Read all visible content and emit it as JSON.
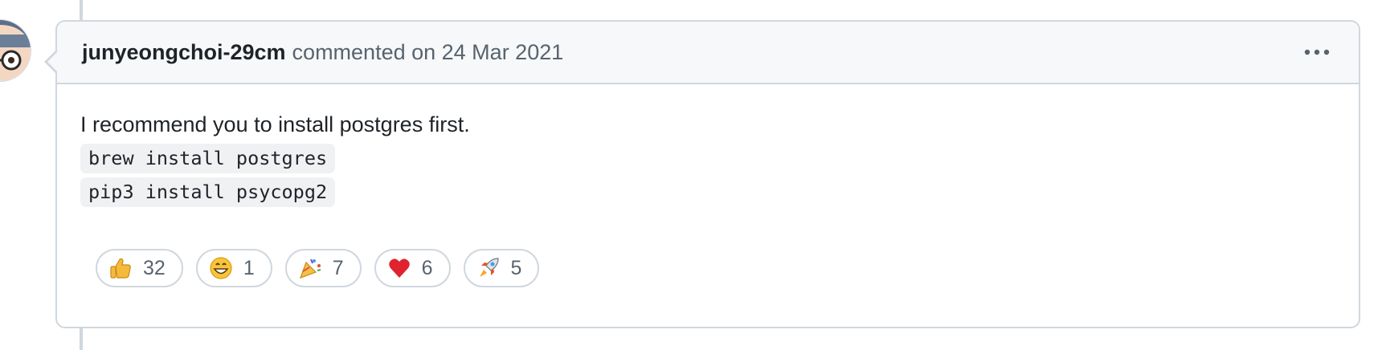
{
  "comment": {
    "author": "junyeongchoi-29cm",
    "meta": "commented on 24 Mar 2021",
    "body_text": "I recommend you to install postgres first.",
    "code_lines": [
      "brew install postgres",
      "pip3 install psycopg2"
    ]
  },
  "reactions": [
    {
      "icon": "thumbs-up-icon",
      "count": "32"
    },
    {
      "icon": "grinning-face-icon",
      "count": "1"
    },
    {
      "icon": "party-popper-icon",
      "count": "7"
    },
    {
      "icon": "red-heart-icon",
      "count": "6"
    },
    {
      "icon": "rocket-icon",
      "count": "5"
    }
  ],
  "colors": {
    "border": "#d0d7de",
    "header_bg": "#f6f8fa",
    "muted_text": "#59636e",
    "code_bg": "#eff1f3"
  }
}
